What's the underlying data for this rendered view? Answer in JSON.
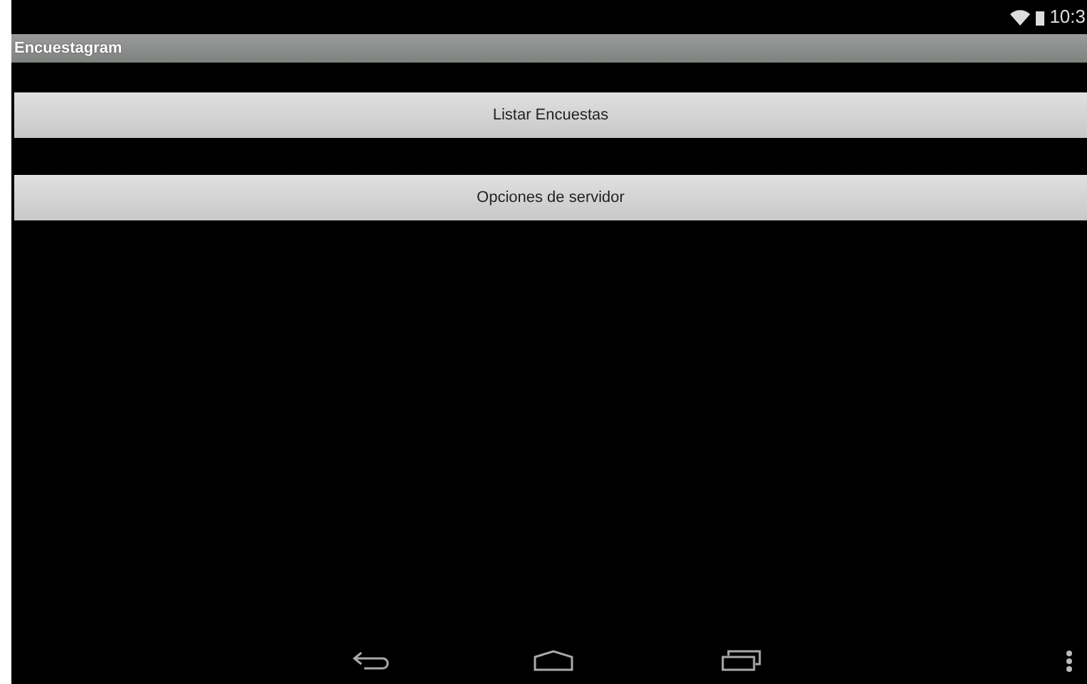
{
  "status_bar": {
    "time": "10:3"
  },
  "action_bar": {
    "title": "Encuestagram"
  },
  "buttons": [
    {
      "label": "Listar Encuestas"
    },
    {
      "label": "Opciones de servidor"
    }
  ]
}
